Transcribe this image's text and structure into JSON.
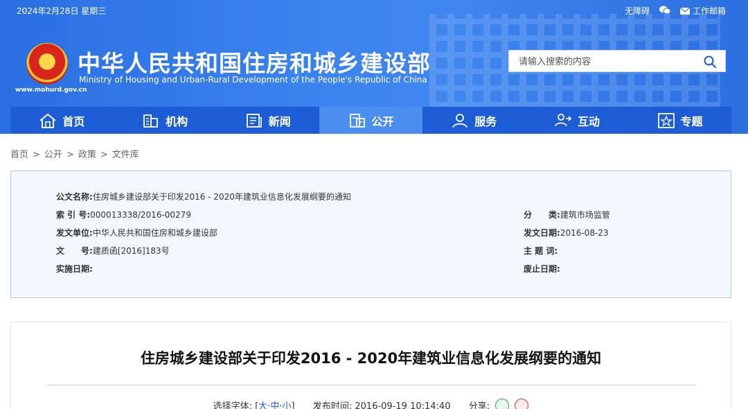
{
  "topbar": {
    "date": "2024年2月28日 星期三",
    "accessibility": "无障碍",
    "email": "工作邮箱"
  },
  "site": {
    "title": "中华人民共和国住房和城乡建设部",
    "subtitle": "Ministry of Housing and Urban-Rural Development of the People's Republic of China",
    "url": "www.mohurd.gov.cn"
  },
  "search": {
    "placeholder": "请输入搜索的内容"
  },
  "nav": [
    {
      "label": "首页"
    },
    {
      "label": "机构"
    },
    {
      "label": "新闻"
    },
    {
      "label": "公开",
      "active": true
    },
    {
      "label": "服务"
    },
    {
      "label": "互动"
    },
    {
      "label": "专题"
    }
  ],
  "breadcrumb": [
    "首页",
    "公开",
    "政策",
    "文件库"
  ],
  "info": {
    "doc_name_label": "公文名称:",
    "doc_name": "住房城乡建设部关于印发2016 - 2020年建筑业信息化发展纲要的通知",
    "index_label": "索 引 号:",
    "index": "000013338/2016-00279",
    "category_label": "分　　类:",
    "category": "建筑市场监管",
    "issuer_label": "发文单位:",
    "issuer": "中华人民共和国住房和城乡建设部",
    "issue_date_label": "发文日期:",
    "issue_date": "2016-08-23",
    "doc_no_label": "文　　号:",
    "doc_no": "建质函[2016]183号",
    "subject_label": "主 题 词:",
    "subject": "",
    "effective_label": "实施日期:",
    "effective": "",
    "expire_label": "废止日期:",
    "expire": ""
  },
  "article": {
    "title": "住房城乡建设部关于印发2016 - 2020年建筑业信息化发展纲要的通知",
    "font_label": "选择字体:",
    "font_open": "[",
    "font_large": "大",
    "font_medium": "中",
    "font_small": "小",
    "font_close": "]",
    "font_sep": "·",
    "publish_label": "发布时间:",
    "publish_time": "2016-09-19 10:14:40",
    "share_label": "分享:"
  },
  "colors": {
    "header_blue": "#2f74e4",
    "nav_blue": "#1c5dd6",
    "nav_active": "#4a8fef",
    "link_blue": "#1a5fd0"
  }
}
